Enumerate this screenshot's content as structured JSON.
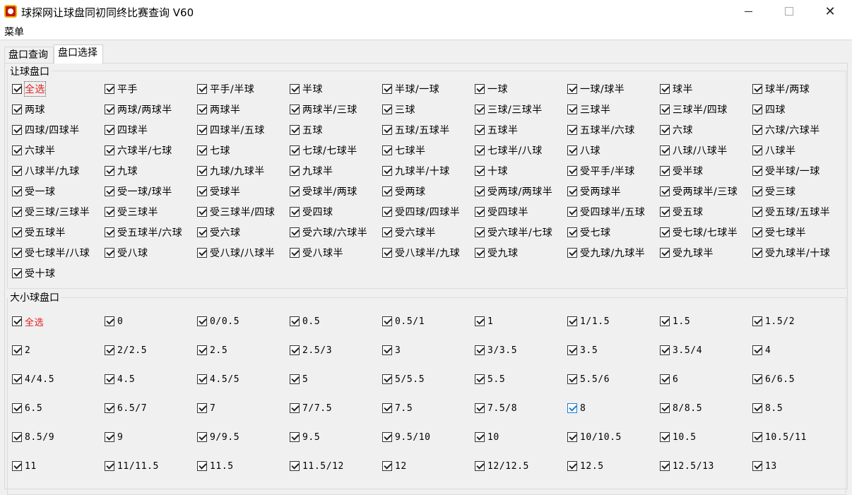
{
  "window": {
    "title": "球探网让球盘同初同终比赛查询 V60",
    "minimize_glyph": "",
    "maximize_glyph": "",
    "close_glyph": "✕"
  },
  "menu": {
    "items": [
      "菜单"
    ]
  },
  "tabs": [
    {
      "label": "盘口查询",
      "active": false
    },
    {
      "label": "盘口选择",
      "active": true
    }
  ],
  "handicap_group": {
    "title": "让球盘口",
    "options": [
      "全选",
      "平手",
      "平手/半球",
      "半球",
      "半球/一球",
      "一球",
      "一球/球半",
      "球半",
      "球半/两球",
      "两球",
      "两球/两球半",
      "两球半",
      "两球半/三球",
      "三球",
      "三球/三球半",
      "三球半",
      "三球半/四球",
      "四球",
      "四球/四球半",
      "四球半",
      "四球半/五球",
      "五球",
      "五球/五球半",
      "五球半",
      "五球半/六球",
      "六球",
      "六球/六球半",
      "六球半",
      "六球半/七球",
      "七球",
      "七球/七球半",
      "七球半",
      "七球半/八球",
      "八球",
      "八球/八球半",
      "八球半",
      "八球半/九球",
      "九球",
      "九球/九球半",
      "九球半",
      "九球半/十球",
      "十球",
      "受平手/半球",
      "受半球",
      "受半球/一球",
      "受一球",
      "受一球/球半",
      "受球半",
      "受球半/两球",
      "受两球",
      "受两球/两球半",
      "受两球半",
      "受两球半/三球",
      "受三球",
      "受三球/三球半",
      "受三球半",
      "受三球半/四球",
      "受四球",
      "受四球/四球半",
      "受四球半",
      "受四球半/五球",
      "受五球",
      "受五球/五球半",
      "受五球半",
      "受五球半/六球",
      "受六球",
      "受六球/六球半",
      "受六球半",
      "受六球半/七球",
      "受七球",
      "受七球/七球半",
      "受七球半",
      "受七球半/八球",
      "受八球",
      "受八球/八球半",
      "受八球半",
      "受八球半/九球",
      "受九球",
      "受九球/九球半",
      "受九球半",
      "受九球半/十球",
      "受十球"
    ]
  },
  "overunder_group": {
    "title": "大小球盘口",
    "options": [
      "全选",
      "0",
      "0/0.5",
      "0.5",
      "0.5/1",
      "1",
      "1/1.5",
      "1.5",
      "1.5/2",
      "2",
      "2/2.5",
      "2.5",
      "2.5/3",
      "3",
      "3/3.5",
      "3.5",
      "3.5/4",
      "4",
      "4/4.5",
      "4.5",
      "4.5/5",
      "5",
      "5/5.5",
      "5.5",
      "5.5/6",
      "6",
      "6/6.5",
      "6.5",
      "6.5/7",
      "7",
      "7/7.5",
      "7.5",
      "7.5/8",
      "8",
      "8/8.5",
      "8.5",
      "8.5/9",
      "9",
      "9/9.5",
      "9.5",
      "9.5/10",
      "10",
      "10/10.5",
      "10.5",
      "10.5/11",
      "11",
      "11/11.5",
      "11.5",
      "11.5/12",
      "12",
      "12/12.5",
      "12.5",
      "12.5/13",
      "13"
    ]
  },
  "colors": {
    "select_all_label": "#e02020",
    "hover_checkbox": "#1a7dd7"
  }
}
